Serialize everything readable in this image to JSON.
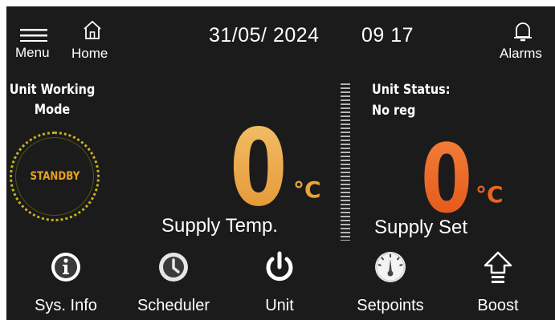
{
  "header": {
    "menu_label": "Menu",
    "home_label": "Home",
    "date": "31/05/ 2024",
    "time": "09 17",
    "alarms_label": "Alarms"
  },
  "mode_panel": {
    "title_line1": "Unit Working",
    "title_line2": "Mode",
    "state": "STANDBY"
  },
  "supply_temp": {
    "value": "0",
    "unit": "°C",
    "label": "Supply Temp."
  },
  "status_panel": {
    "title": "Unit Status:",
    "value": "No reg"
  },
  "supply_set": {
    "value": "0",
    "unit": "°C",
    "label": "Supply Set"
  },
  "nav": [
    {
      "label": "Sys. Info",
      "icon": "info-icon"
    },
    {
      "label": "Scheduler",
      "icon": "clock-icon"
    },
    {
      "label": "Unit",
      "icon": "power-icon"
    },
    {
      "label": "Setpoints",
      "icon": "gauge-icon"
    },
    {
      "label": "Boost",
      "icon": "boost-arrow-icon"
    }
  ],
  "colors": {
    "background": "#1b1b1b",
    "supply_temp": "#e9a43a",
    "supply_set": "#e9651f",
    "standby_ring": "#c9b21c"
  }
}
